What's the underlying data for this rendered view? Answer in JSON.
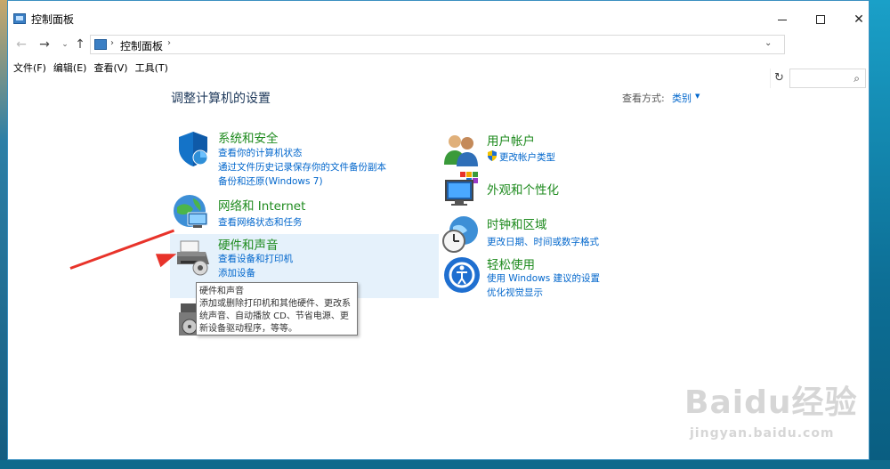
{
  "window": {
    "title": "控制面板",
    "controls": {
      "minimize": "—",
      "maximize": "☐",
      "close": "✕"
    }
  },
  "address": {
    "back": "←",
    "forward": "→",
    "recent": "⌄",
    "up": "↑",
    "path": "控制面板",
    "sep": "›",
    "dropdown": "⌄",
    "refresh": "↻",
    "search_placeholder": "",
    "search_icon": "⌕"
  },
  "menubar": {
    "items": [
      "文件(F)",
      "编辑(E)",
      "查看(V)",
      "工具(T)"
    ]
  },
  "main": {
    "title": "调整计算机的设置",
    "view_by_label": "查看方式:",
    "view_by_value": "类别",
    "view_arrow": "▼"
  },
  "categories": {
    "security": {
      "title": "系统和安全",
      "links": [
        "查看你的计算机状态",
        "通过文件历史记录保存你的文件备份副本",
        "备份和还原(Windows 7)"
      ],
      "icon": "shield-icon"
    },
    "network": {
      "title": "网络和 Internet",
      "links": [
        "查看网络状态和任务"
      ],
      "icon": "globe-network-icon"
    },
    "hardware": {
      "title": "硬件和声音",
      "links": [
        "查看设备和打印机",
        "添加设备"
      ],
      "icon": "printer-icon"
    },
    "programs": {
      "icon": "programs-icon"
    },
    "users": {
      "title": "用户帐户",
      "links": [
        "更改帐户类型"
      ],
      "icon": "users-icon"
    },
    "appearance": {
      "title": "外观和个性化",
      "icon": "monitor-icon"
    },
    "clock": {
      "title": "时钟和区域",
      "links": [
        "更改日期、时间或数字格式"
      ],
      "icon": "clock-globe-icon"
    },
    "ease": {
      "title": "轻松使用",
      "links": [
        "使用 Windows 建议的设置",
        "优化视觉显示"
      ],
      "icon": "ease-of-access-icon"
    }
  },
  "tooltip": {
    "title": "硬件和声音",
    "body": "添加或删除打印机和其他硬件、更改系统声音、自动播放 CD、节省电源、更新设备驱动程序，等等。"
  },
  "watermark": {
    "text": "Baidu经验",
    "sub": "jingyan.baidu.com"
  },
  "colors": {
    "category_title": "#1d8a1d",
    "link": "#0066cc",
    "title": "#1e395b",
    "hover": "#e5f1fb",
    "annotation_arrow": "#e8332a"
  }
}
